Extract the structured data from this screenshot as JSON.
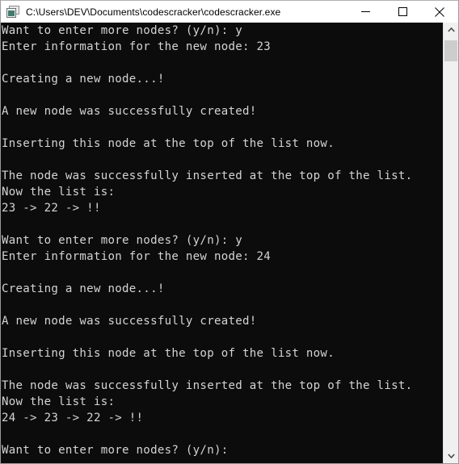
{
  "window": {
    "title": "C:\\Users\\DEV\\Documents\\codescracker\\codescracker.exe",
    "icon": "console-window-icon",
    "background_color": "#ffffff",
    "border_color": "#9a9a9a"
  },
  "titlebar_controls": {
    "minimize_label": "Minimize",
    "maximize_label": "Maximize",
    "close_label": "Close"
  },
  "console": {
    "background_color": "#0c0c0c",
    "text_color": "#d4d4d4",
    "lines": [
      "Want to enter more nodes? (y/n): y",
      "Enter information for the new node: 23",
      "",
      "Creating a new node...!",
      "",
      "A new node was successfully created!",
      "",
      "Inserting this node at the top of the list now.",
      "",
      "The node was successfully inserted at the top of the list.",
      "Now the list is:",
      "23 -> 22 -> !!",
      "",
      "Want to enter more nodes? (y/n): y",
      "Enter information for the new node: 24",
      "",
      "Creating a new node...!",
      "",
      "A new node was successfully created!",
      "",
      "Inserting this node at the top of the list now.",
      "",
      "The node was successfully inserted at the top of the list.",
      "Now the list is:",
      "24 -> 23 -> 22 -> !!",
      "",
      "Want to enter more nodes? (y/n):"
    ],
    "text": "Want to enter more nodes? (y/n): y\nEnter information for the new node: 23\n\nCreating a new node...!\n\nA new node was successfully created!\n\nInserting this node at the top of the list now.\n\nThe node was successfully inserted at the top of the list.\nNow the list is:\n23 -> 22 -> !!\n\nWant to enter more nodes? (y/n): y\nEnter information for the new node: 24\n\nCreating a new node...!\n\nA new node was successfully created!\n\nInserting this node at the top of the list now.\n\nThe node was successfully inserted at the top of the list.\nNow the list is:\n24 -> 23 -> 22 -> !!\n\nWant to enter more nodes? (y/n):"
  },
  "scrollbar": {
    "up_arrow_glyph": "⌃",
    "down_arrow_glyph": "⌄",
    "thumb_color": "#cdcdcd",
    "track_color": "#f0f0f0"
  }
}
